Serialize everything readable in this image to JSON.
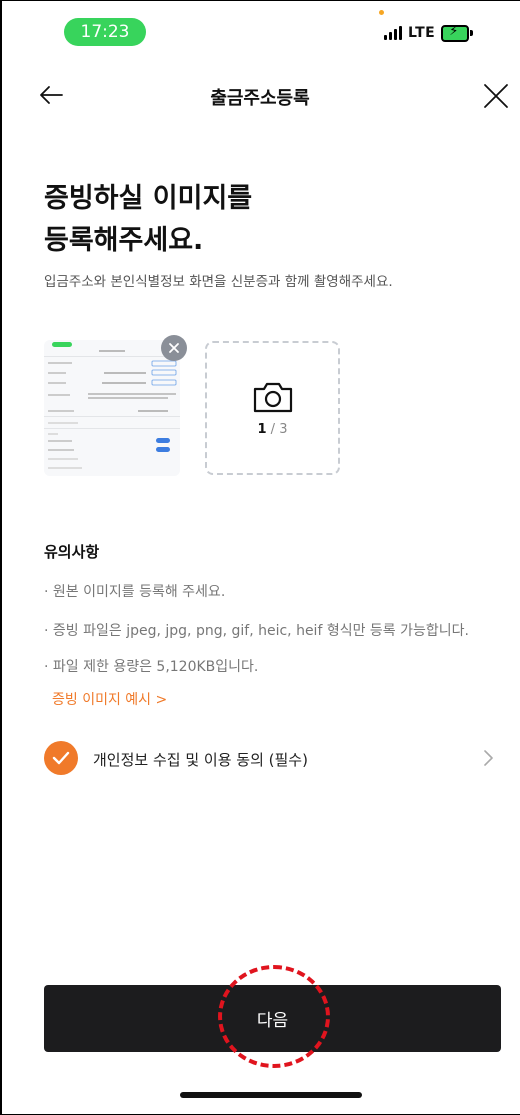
{
  "status_bar": {
    "time": "17:23",
    "network": "LTE",
    "icons": [
      "signal-icon",
      "battery-charging-icon"
    ]
  },
  "header": {
    "title": "출금주소등록",
    "back_icon": "arrow-left-icon",
    "close_icon": "close-icon"
  },
  "main": {
    "headline_line1": "증빙하실 이미지를",
    "headline_line2": "등록해주세요.",
    "subtitle": "입금주소와 본인식별정보 화면을 신분증과 함께 촬영해주세요.",
    "upload": {
      "count_current": "1",
      "count_separator": " / ",
      "count_max": "3",
      "camera_icon": "camera-icon",
      "remove_icon": "close-icon"
    }
  },
  "notes": {
    "title": "유의사항",
    "items": [
      "원본 이미지를 등록해 주세요.",
      "증빙 파일은 jpeg, jpg, png, gif, heic, heif 형식만 등록 가능합니다.",
      "파일 제한 용량은 5,120KB입니다."
    ],
    "example_link": "증빙 이미지 예시 >"
  },
  "consent": {
    "label": "개인정보 수집 및 이용 동의 (필수)",
    "checked": true
  },
  "footer": {
    "next_label": "다음"
  },
  "colors": {
    "accent": "#f07a2a",
    "button_bg": "#1c1c1e",
    "status_green": "#38d45c",
    "annotation_red": "#e0141e"
  }
}
